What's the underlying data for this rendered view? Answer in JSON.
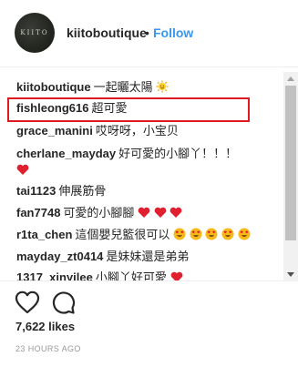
{
  "post_header": {
    "avatar_text": "KIITO",
    "username": "kiitoboutique",
    "separator": "•",
    "follow_label": "Follow"
  },
  "comments": [
    {
      "user": "kiitoboutique",
      "text": "一起曬太陽",
      "emojis": [
        "sun-face"
      ]
    },
    {
      "user": "fishleong616",
      "text": "超可愛",
      "emojis": []
    },
    {
      "user": "grace_manini",
      "text": "哎呀呀，小宝贝",
      "emojis": []
    },
    {
      "user": "cherlane_mayday",
      "text": "好可愛的小腳丫！！！",
      "emojis": [
        "red-heart"
      ]
    },
    {
      "user": "tai1123",
      "text": "伸展筋骨",
      "emojis": []
    },
    {
      "user": "fan7748",
      "text": "可愛的小腳腳",
      "emojis": [
        "red-heart",
        "red-heart",
        "red-heart"
      ]
    },
    {
      "user": "r1ta_chen",
      "text": "這個嬰兒籃很可以",
      "emojis": [
        "heart-eyes",
        "heart-eyes",
        "heart-eyes",
        "heart-eyes",
        "heart-eyes"
      ]
    },
    {
      "user": "mayday_zt0414",
      "text": "是妹妹還是弟弟",
      "emojis": []
    },
    {
      "user": "1317_xinyilee",
      "text": "小腳丫好可愛",
      "emojis": [
        "red-heart"
      ]
    }
  ],
  "highlighted_comment_index": 1,
  "highlight_color": "#e0181f",
  "actions": {
    "like_icon": "heart-outline-icon",
    "comment_icon": "speech-bubble-icon",
    "likes_text": "7,622 likes",
    "time_ago": "23 HOURS AGO"
  },
  "colors": {
    "follow": "#3897f0",
    "text": "#262626",
    "muted": "#999999"
  }
}
